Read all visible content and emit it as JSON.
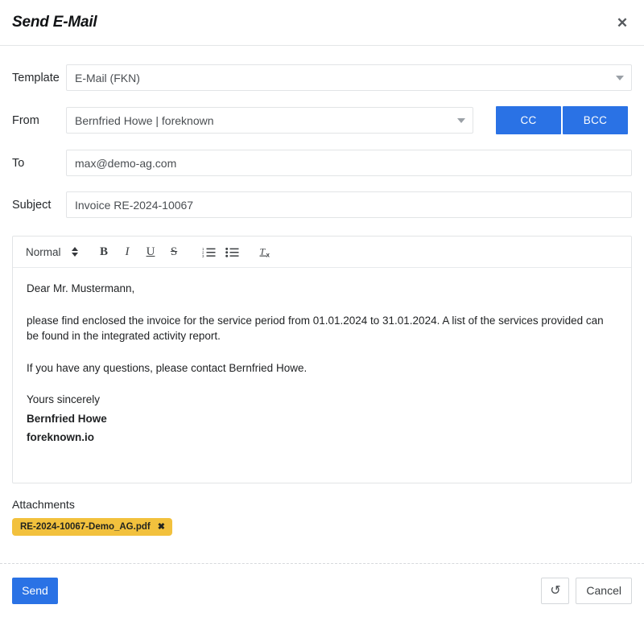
{
  "dialog": {
    "title": "Send E-Mail",
    "close_icon": "close-icon"
  },
  "form": {
    "template": {
      "label": "Template",
      "value": "E-Mail (FKN)",
      "caret_icon": "chevron-down-icon"
    },
    "from": {
      "label": "From",
      "value": "Bernfried Howe | foreknown",
      "caret_icon": "chevron-down-icon"
    },
    "cc_label": "CC",
    "bcc_label": "BCC",
    "to": {
      "label": "To",
      "value": "max@demo-ag.com"
    },
    "subject": {
      "label": "Subject",
      "value": "Invoice RE-2024-10067"
    }
  },
  "editor": {
    "toolbar": {
      "block_format": "Normal",
      "stepper_icon": "stepper-updown-icon",
      "bold_label": "B",
      "italic_label": "I",
      "underline_label": "U",
      "strike_label": "S",
      "ordered_list_icon": "ordered-list-icon",
      "bullet_list_icon": "bullet-list-icon",
      "clear_format_label": "Tx"
    },
    "body": {
      "greeting": "Dear Mr. Mustermann,",
      "paragraph1": "please find enclosed the invoice for the service period from 01.01.2024 to 31.01.2024. A list of the services provided can be found in the integrated activity report.",
      "paragraph2": "If you have any questions, please contact Bernfried Howe.",
      "closing": "Yours sincerely",
      "signature_name": "Bernfried Howe",
      "signature_company": "foreknown.io"
    }
  },
  "attachments": {
    "label": "Attachments",
    "items": [
      {
        "name": "RE-2024-10067-Demo_AG.pdf",
        "remove_icon": "✖"
      }
    ]
  },
  "footer": {
    "send_label": "Send",
    "reset_icon": "↺",
    "cancel_label": "Cancel"
  },
  "colors": {
    "accent_blue": "#2a72e5",
    "chip_amber": "#f2c13d",
    "border_gray": "#e2e4e6"
  }
}
